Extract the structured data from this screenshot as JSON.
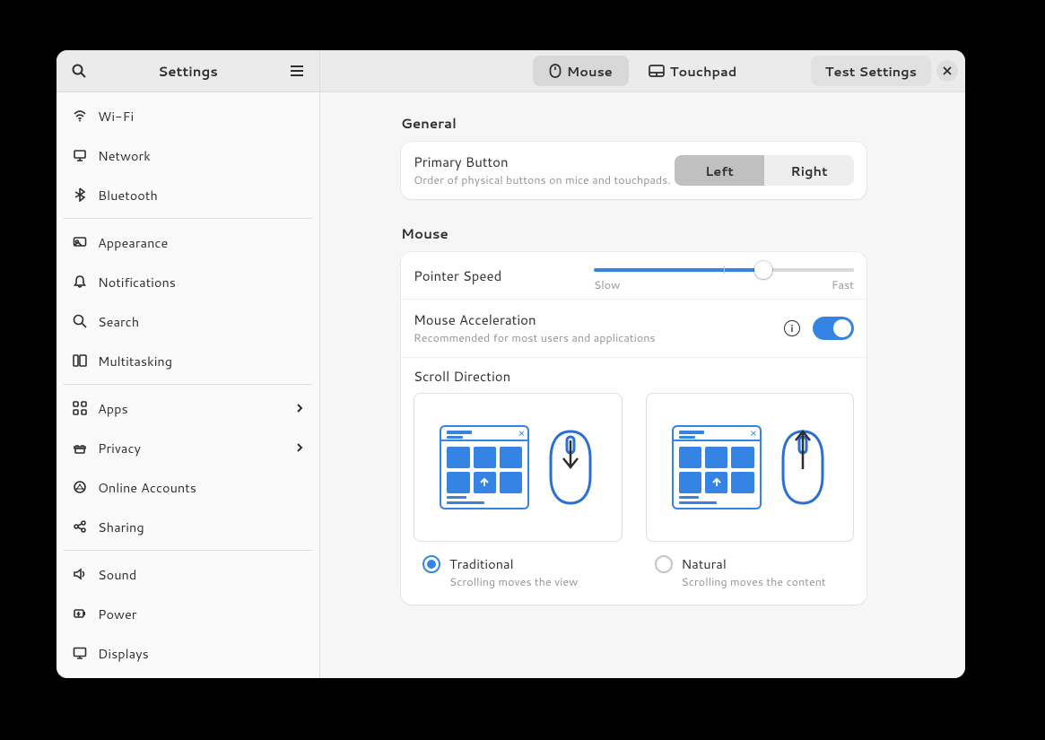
{
  "app": {
    "title": "Settings"
  },
  "sidebar": {
    "items": [
      {
        "label": "Wi-Fi",
        "icon": "wifi-icon"
      },
      {
        "label": "Network",
        "icon": "network-icon"
      },
      {
        "label": "Bluetooth",
        "icon": "bluetooth-icon"
      },
      {
        "sep": true
      },
      {
        "label": "Appearance",
        "icon": "appearance-icon"
      },
      {
        "label": "Notifications",
        "icon": "bell-icon"
      },
      {
        "label": "Search",
        "icon": "magnifier-icon"
      },
      {
        "label": "Multitasking",
        "icon": "multitasking-icon"
      },
      {
        "sep": true
      },
      {
        "label": "Apps",
        "icon": "apps-icon",
        "chevron": true
      },
      {
        "label": "Privacy",
        "icon": "privacy-icon",
        "chevron": true
      },
      {
        "label": "Online Accounts",
        "icon": "online-accounts-icon"
      },
      {
        "label": "Sharing",
        "icon": "sharing-icon"
      },
      {
        "sep": true
      },
      {
        "label": "Sound",
        "icon": "sound-icon"
      },
      {
        "label": "Power",
        "icon": "power-icon"
      },
      {
        "label": "Displays",
        "icon": "displays-icon"
      }
    ]
  },
  "header": {
    "tabs": {
      "mouse": "Mouse",
      "touchpad": "Touchpad",
      "active": "mouse"
    },
    "test": "Test Settings"
  },
  "general": {
    "title": "General",
    "primary_button": {
      "label": "Primary Button",
      "sub": "Order of physical buttons on mice and touchpads.",
      "options": {
        "left": "Left",
        "right": "Right"
      },
      "selected": "left"
    }
  },
  "mouse": {
    "title": "Mouse",
    "pointer_speed": {
      "label": "Pointer Speed",
      "min_label": "Slow",
      "max_label": "Fast",
      "value_percent": 65
    },
    "acceleration": {
      "label": "Mouse Acceleration",
      "sub": "Recommended for most users and applications",
      "enabled": true
    },
    "scroll": {
      "label": "Scroll Direction",
      "traditional": {
        "title": "Traditional",
        "sub": "Scrolling moves the view"
      },
      "natural": {
        "title": "Natural",
        "sub": "Scrolling moves the content"
      },
      "selected": "traditional"
    }
  },
  "colors": {
    "accent": "#3584e4"
  }
}
